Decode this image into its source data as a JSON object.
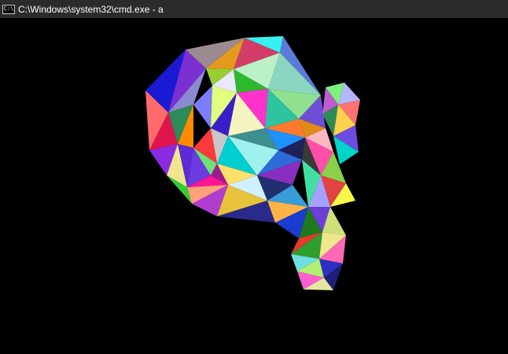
{
  "window": {
    "title": "C:\\Windows\\system32\\cmd.exe - a",
    "icon": "cmd-console-icon",
    "icon_glyph": "C:\\",
    "background": "#000000",
    "titlebar_color": "#2b2b2b"
  },
  "viewport": {
    "content": "random-colored-triangle-mesh"
  }
}
